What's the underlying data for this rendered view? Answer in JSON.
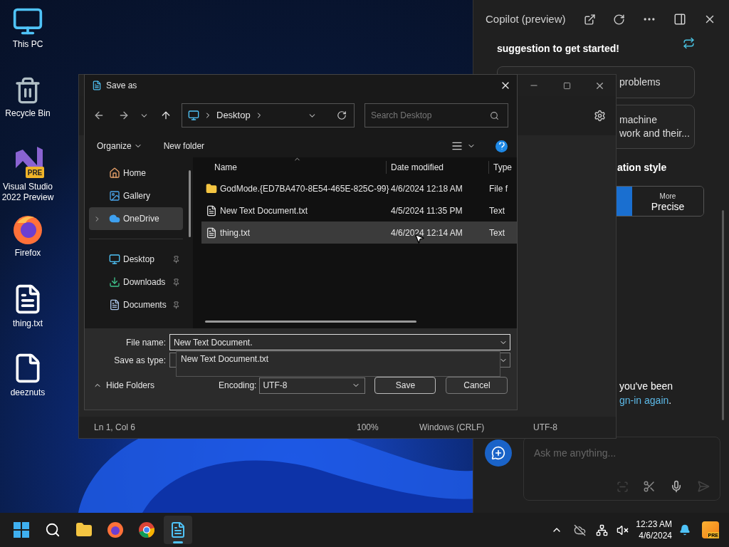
{
  "desktop_icons": [
    {
      "kind": "pc",
      "label": "This PC"
    },
    {
      "kind": "bin",
      "label": "Recycle Bin"
    },
    {
      "kind": "vs",
      "label": "Visual Studio 2022 Preview",
      "badge": "PRE"
    },
    {
      "kind": "firefox",
      "label": "Firefox"
    },
    {
      "kind": "textfile",
      "label": "thing.txt"
    },
    {
      "kind": "blank",
      "label": "deeznuts"
    }
  ],
  "copilot": {
    "title": "Copilot (preview)",
    "intro": "suggestion to get started!",
    "suggestions": [
      {
        "lines": [
          "problems"
        ]
      },
      {
        "lines": [
          "machine",
          "work and their..."
        ]
      }
    ],
    "style_heading": "ation style",
    "style_segments": [
      {
        "selected": true
      },
      {
        "top": "More",
        "label": "Precise",
        "selected": false
      }
    ],
    "notice": {
      "line": "you've been",
      "link": "gn-in again",
      "end": "."
    },
    "input": {
      "placeholder": "Ask me anything..."
    }
  },
  "notepad": {
    "status_bar": [
      "Ln 1, Col 6",
      "100%",
      "Windows (CRLF)",
      "UTF-8"
    ]
  },
  "dialog": {
    "title": "Save as",
    "breadcrumb": [
      "Desktop"
    ],
    "search": {
      "placeholder": "Search Desktop"
    },
    "toolbar": [
      "Organize",
      "New folder"
    ],
    "nav_items": [
      {
        "kind": "home",
        "label": "Home",
        "selected": false,
        "pinned": false
      },
      {
        "kind": "gallery",
        "label": "Gallery",
        "selected": false,
        "pinned": false
      },
      {
        "kind": "cloud",
        "label": "OneDrive",
        "selected": true,
        "pinned": false,
        "expandable": true
      },
      {
        "kind": "divider"
      },
      {
        "kind": "desktop",
        "label": "Desktop",
        "selected": false,
        "pinned": true
      },
      {
        "kind": "downloads",
        "label": "Downloads",
        "selected": false,
        "pinned": true
      },
      {
        "kind": "documents",
        "label": "Documents",
        "selected": false,
        "pinned": true
      }
    ],
    "columns": [
      "Name",
      "Date modified",
      "Type"
    ],
    "files": [
      {
        "kind": "folder",
        "name": "GodMode.{ED7BA470-8E54-465E-825C-99}",
        "date": "4/6/2024 12:18 AM",
        "type": "File f",
        "selected": false
      },
      {
        "kind": "text",
        "name": "New Text Document.txt",
        "date": "4/5/2024 11:35 PM",
        "type": "Text",
        "selected": false
      },
      {
        "kind": "text",
        "name": "thing.txt",
        "date": "4/6/2024 12:14 AM",
        "type": "Text",
        "selected": true
      }
    ],
    "file_name_label": "File name:",
    "file_name_value": "New Text Document.",
    "suggestion": "New Text Document.txt",
    "save_type_label": "Save as type:",
    "hide_folders": "Hide Folders",
    "encoding_label": "Encoding:",
    "encoding_value": "UTF-8",
    "buttons": [
      "Save",
      "Cancel"
    ]
  },
  "taskbar": {
    "apps": [
      {
        "kind": "start",
        "selected": false
      },
      {
        "kind": "search",
        "selected": false
      },
      {
        "kind": "explorer",
        "selected": false
      },
      {
        "kind": "firefox",
        "selected": false
      },
      {
        "kind": "chrome",
        "selected": false
      },
      {
        "kind": "notepad",
        "selected": true
      }
    ],
    "time": "12:23 AM",
    "date": "4/6/2024",
    "copilot_badge": "PRE"
  }
}
